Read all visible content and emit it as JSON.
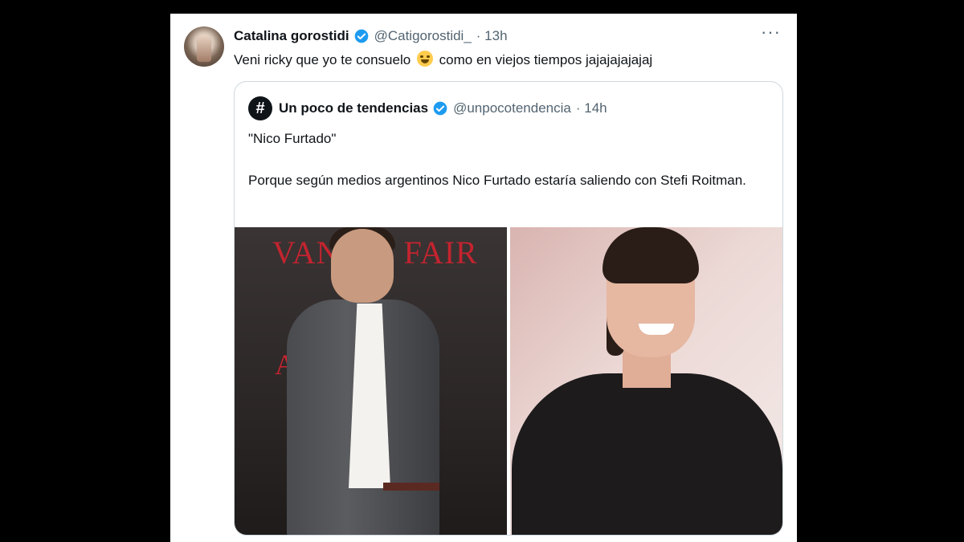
{
  "tweet": {
    "author_name": "Catalina gorostidi",
    "author_handle": "@Catigorostidi_",
    "time": "· 13h",
    "text_before_emoji": "Veni ricky que yo te consuelo",
    "emoji": "crying-laughing-emoji",
    "text_after_emoji": "como en viejos tiempos jajajajajajaj",
    "more_label": "···"
  },
  "quote": {
    "avatar_symbol": "#",
    "author_name": "Un poco de tendencias",
    "author_handle": "@unpocotendencia",
    "time": "· 14h",
    "line1": "\"Nico Furtado\"",
    "line2": "Porque según medios argentinos Nico Furtado estaría saliendo con Stefi Roitman.",
    "images": {
      "left_brand_text": "VANITY FAIR",
      "left_brand_letter": "A"
    }
  },
  "colors": {
    "verified": "#1d9bf0",
    "text": "#0f1419",
    "muted": "#536471",
    "border": "#cfd9de"
  }
}
